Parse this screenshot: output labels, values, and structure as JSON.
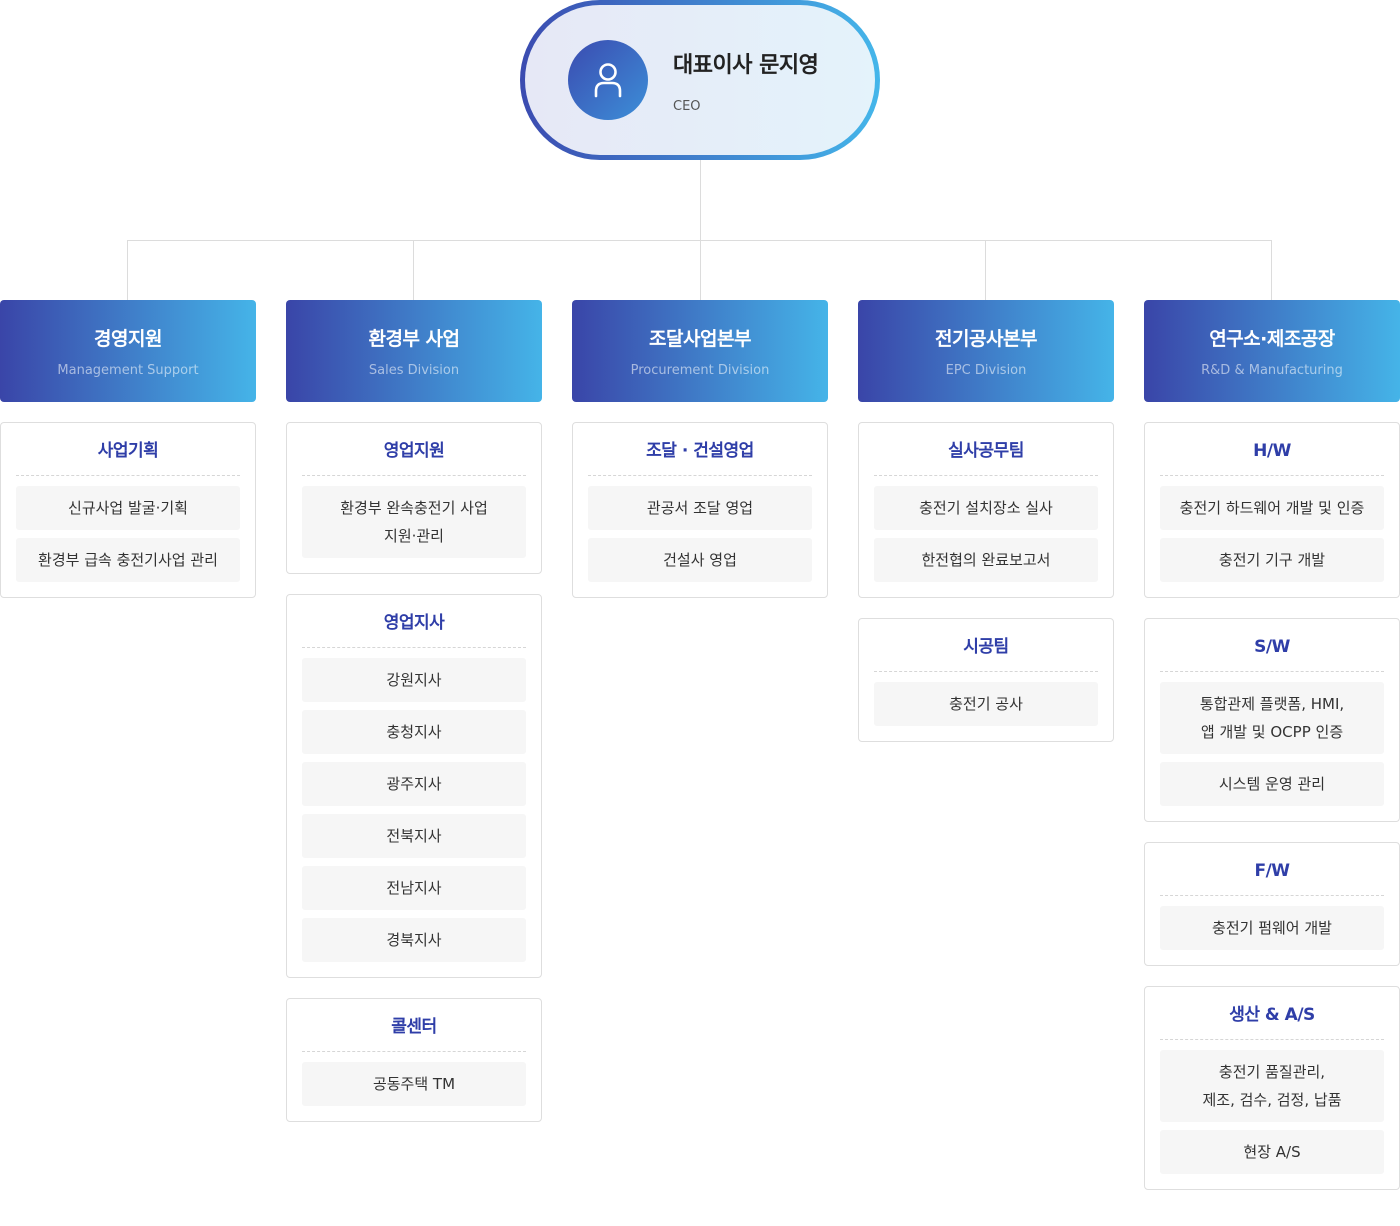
{
  "ceo": {
    "name": "대표이사 문지영",
    "role": "CEO",
    "icon": "person-icon"
  },
  "colors": {
    "gradient_start": "#3a45a8",
    "gradient_end": "#45b4e8",
    "team_title": "#2f3ea8"
  },
  "divisions": [
    {
      "title": "경영지원",
      "subtitle": "Management Support",
      "teams": [
        {
          "title": "사업기획",
          "items": [
            "신규사업 발굴·기획",
            "환경부 급속 충전기사업 관리"
          ]
        }
      ]
    },
    {
      "title": "환경부 사업",
      "subtitle": "Sales Division",
      "teams": [
        {
          "title": "영업지원",
          "items": [
            "환경부 완속충전기 사업\n지원·관리"
          ]
        },
        {
          "title": "영업지사",
          "items": [
            "강원지사",
            "충청지사",
            "광주지사",
            "전북지사",
            "전남지사",
            "경북지사"
          ]
        },
        {
          "title": "콜센터",
          "items": [
            "공동주택 TM"
          ]
        }
      ]
    },
    {
      "title": "조달사업본부",
      "subtitle": "Procurement Division",
      "teams": [
        {
          "title": "조달 · 건설영업",
          "items": [
            "관공서 조달 영업",
            "건설사 영업"
          ]
        }
      ]
    },
    {
      "title": "전기공사본부",
      "subtitle": "EPC Division",
      "teams": [
        {
          "title": "실사공무팀",
          "items": [
            "충전기 설치장소 실사",
            "한전협의 완료보고서"
          ]
        },
        {
          "title": "시공팀",
          "items": [
            "충전기 공사"
          ]
        }
      ]
    },
    {
      "title": "연구소·제조공장",
      "subtitle": "R&D & Manufacturing",
      "teams": [
        {
          "title": "H/W",
          "items": [
            "충전기 하드웨어 개발 및 인증",
            "충전기 기구 개발"
          ]
        },
        {
          "title": "S/W",
          "items": [
            "통합관제 플랫폼, HMI,\n앱 개발 및 OCPP 인증",
            "시스템 운영 관리"
          ]
        },
        {
          "title": "F/W",
          "items": [
            "충전기 펌웨어 개발"
          ]
        },
        {
          "title": "생산 & A/S",
          "items": [
            "충전기 품질관리,\n제조, 검수, 검정, 납품",
            "현장 A/S"
          ]
        }
      ]
    }
  ]
}
